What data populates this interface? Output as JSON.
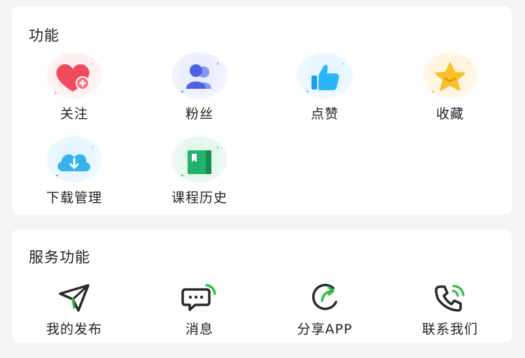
{
  "functions": {
    "title": "功能",
    "items": [
      {
        "label": "关注",
        "icon": "heart-plus-icon",
        "color": "#f0485a"
      },
      {
        "label": "粉丝",
        "icon": "users-icon",
        "color": "#5a6ee8"
      },
      {
        "label": "点赞",
        "icon": "thumbs-up-icon",
        "color": "#2da8f5"
      },
      {
        "label": "收藏",
        "icon": "star-icon",
        "color": "#f6b820"
      },
      {
        "label": "下载管理",
        "icon": "cloud-download-icon",
        "color": "#35b1ec"
      },
      {
        "label": "课程历史",
        "icon": "book-icon",
        "color": "#1fb46b"
      }
    ]
  },
  "services": {
    "title": "服务功能",
    "items": [
      {
        "label": "我的发布",
        "icon": "paper-plane-icon"
      },
      {
        "label": "消息",
        "icon": "message-icon"
      },
      {
        "label": "分享APP",
        "icon": "share-icon"
      },
      {
        "label": "联系我们",
        "icon": "phone-icon"
      }
    ]
  },
  "colors": {
    "accent_green": "#2fbf4a",
    "stroke": "#2a2a2a"
  }
}
